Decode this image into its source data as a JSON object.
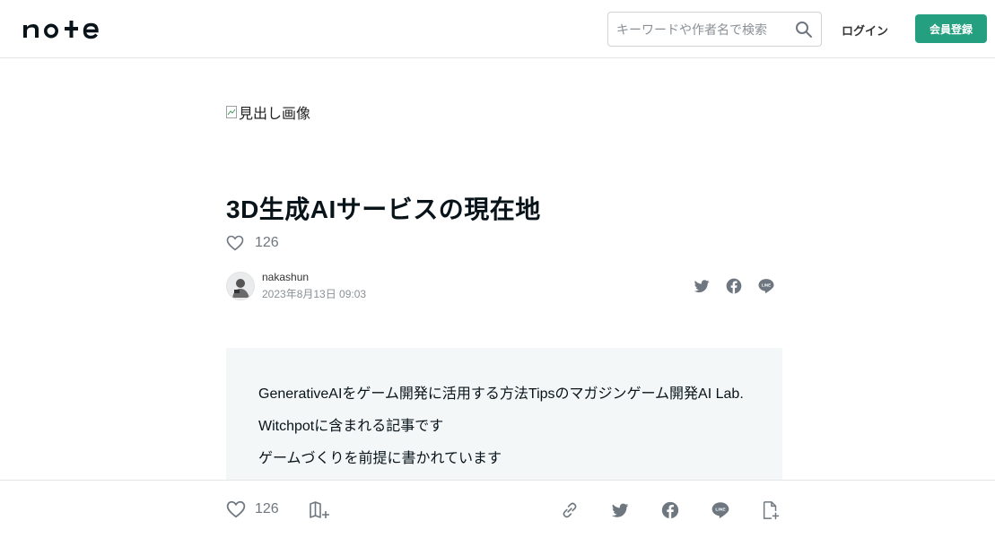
{
  "header": {
    "logo_text": "note",
    "search_placeholder": "キーワードや作者名で検索",
    "login_label": "ログイン",
    "signup_label": "会員登録",
    "accent_color": "#249f80"
  },
  "article": {
    "hero_alt": "見出し画像",
    "title": "3D生成AIサービスの現在地",
    "like_count": "126",
    "author_name": "nakashun",
    "published": "2023年8月13日 09:03",
    "share_icons": [
      "twitter-icon",
      "facebook-icon",
      "line-icon"
    ],
    "intro_lines": [
      "GenerativeAIをゲーム開発に活用する方法Tipsのマガジンゲーム開発AI Lab.",
      "Witchpotに含まれる記事です",
      "ゲームづくりを前提に書かれています"
    ]
  },
  "bottom_bar": {
    "like_count": "126",
    "icons": [
      "heart-icon",
      "add-to-magazine-icon",
      "link-icon",
      "twitter-icon",
      "facebook-icon",
      "line-icon",
      "embed-note-icon"
    ]
  }
}
